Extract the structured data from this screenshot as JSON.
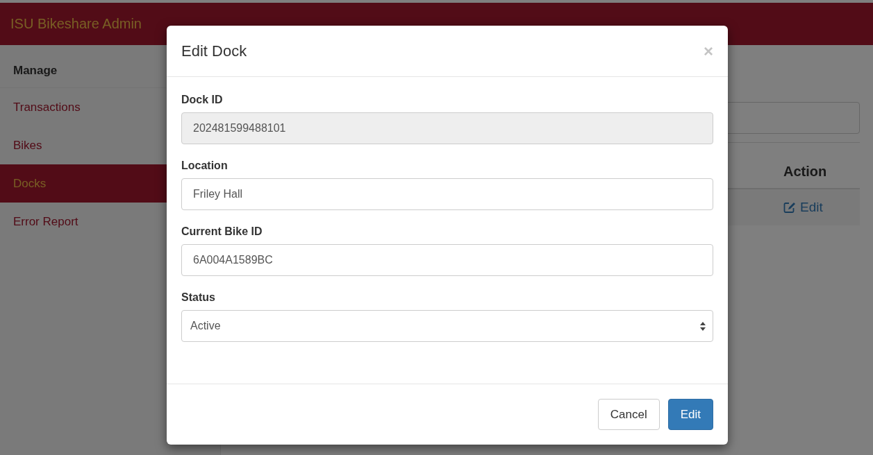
{
  "app": {
    "title": "ISU Bikeshare Admin"
  },
  "sidebar": {
    "heading": "Manage",
    "items": [
      {
        "label": "Transactions",
        "selected": false
      },
      {
        "label": "Bikes",
        "selected": false
      },
      {
        "label": "Docks",
        "selected": true
      },
      {
        "label": "Error Report",
        "selected": false
      }
    ]
  },
  "table": {
    "columns": [
      "Action"
    ],
    "rows": [
      {
        "action": "Edit"
      }
    ]
  },
  "modal": {
    "title": "Edit Dock",
    "close": "×",
    "fields": [
      {
        "kind": "text",
        "label": "Dock ID",
        "value": "202481599488101",
        "disabled": true
      },
      {
        "kind": "text",
        "label": "Location",
        "value": "Friley Hall",
        "disabled": false
      },
      {
        "kind": "text",
        "label": "Current Bike ID",
        "value": "6A004A1589BC",
        "disabled": false
      },
      {
        "kind": "select",
        "label": "Status",
        "value": "Active",
        "disabled": false
      }
    ],
    "buttons": [
      {
        "kind": "default",
        "label": "Cancel"
      },
      {
        "kind": "primary",
        "label": "Edit"
      }
    ]
  }
}
